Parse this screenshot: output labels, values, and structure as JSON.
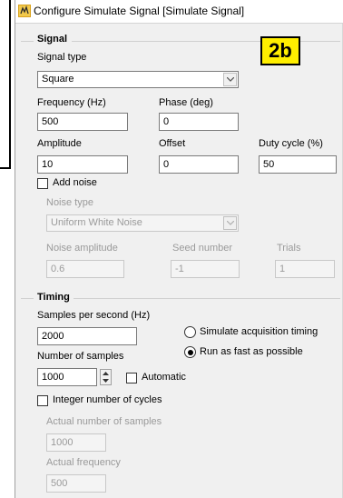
{
  "window": {
    "title": "Configure Simulate Signal [Simulate Signal]"
  },
  "annotation_badge": "2b",
  "signal": {
    "section_title": "Signal",
    "signal_type_label": "Signal type",
    "signal_type_value": "Square",
    "frequency_label": "Frequency (Hz)",
    "frequency_value": "500",
    "phase_label": "Phase (deg)",
    "phase_value": "0",
    "amplitude_label": "Amplitude",
    "amplitude_value": "10",
    "offset_label": "Offset",
    "offset_value": "0",
    "duty_cycle_label": "Duty cycle (%)",
    "duty_cycle_value": "50",
    "add_noise_label": "Add noise",
    "add_noise_checked": false,
    "noise_type_label": "Noise type",
    "noise_type_value": "Uniform White Noise",
    "noise_amplitude_label": "Noise amplitude",
    "noise_amplitude_value": "0.6",
    "seed_number_label": "Seed number",
    "seed_number_value": "-1",
    "trials_label": "Trials",
    "trials_value": "1"
  },
  "timing": {
    "section_title": "Timing",
    "samples_per_second_label": "Samples per second (Hz)",
    "samples_per_second_value": "2000",
    "simulate_timing_label": "Simulate acquisition timing",
    "run_fast_label": "Run as fast as possible",
    "selected_timing_mode": "Run as fast as possible",
    "number_of_samples_label": "Number of samples",
    "number_of_samples_value": "1000",
    "automatic_label": "Automatic",
    "automatic_checked": false,
    "integer_cycles_label": "Integer number of cycles",
    "integer_cycles_checked": false,
    "actual_samples_label": "Actual number of samples",
    "actual_samples_value": "1000",
    "actual_frequency_label": "Actual frequency",
    "actual_frequency_value": "500"
  },
  "colors": {
    "badge": "#ffee00",
    "window_bg": "#f0f0f0",
    "disabled_text": "#9a9a9a"
  }
}
